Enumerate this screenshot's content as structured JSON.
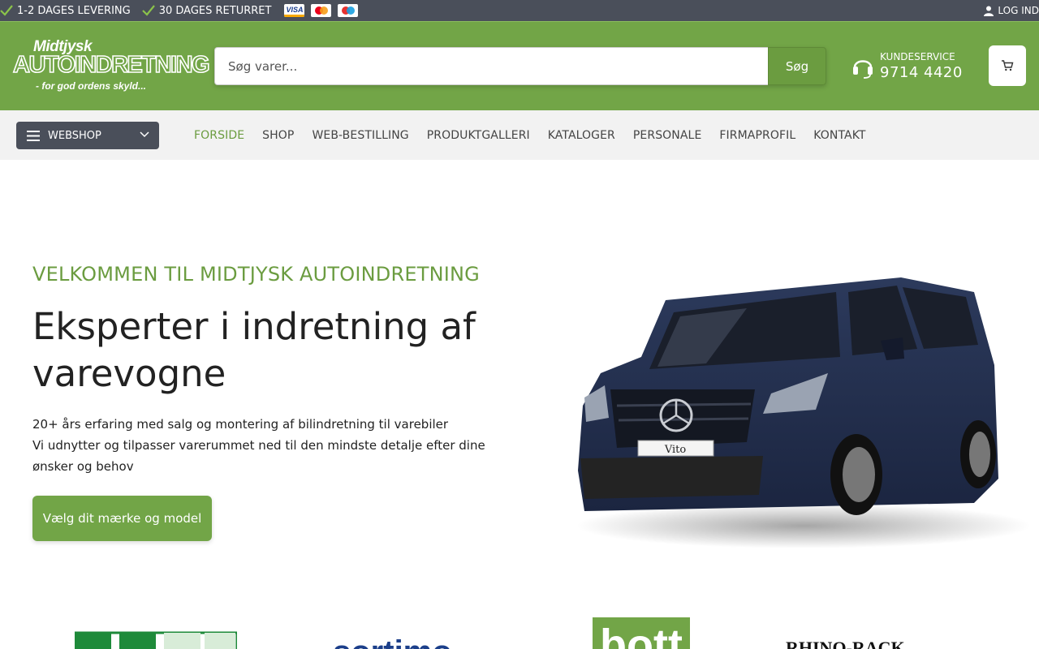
{
  "topbar": {
    "usp": [
      "1-2 DAGES LEVERING",
      "30 DAGES RETURRET"
    ],
    "cards": [
      "visa-card-icon",
      "mastercard-icon",
      "maestro-card-icon"
    ],
    "card_visa_label": "VISA",
    "login_label": "LOG IND"
  },
  "header": {
    "logo": {
      "line1": "Midtjysk",
      "line2": "AUTOINDRETNING",
      "tagline": "- for god ordens skyld..."
    },
    "search_placeholder": "Søg varer...",
    "search_button": "Søg",
    "service_label": "KUNDESERVICE",
    "service_phone": "9714 4420"
  },
  "nav": {
    "webshop_label": "WEBSHOP",
    "items": [
      "FORSIDE",
      "SHOP",
      "WEB-BESTILLING",
      "PRODUKTGALLERI",
      "KATALOGER",
      "PERSONALE",
      "FIRMAPROFIL",
      "KONTAKT"
    ],
    "active": "FORSIDE"
  },
  "hero": {
    "eyebrow": "VELKOMMEN TIL MIDTJYSK AUTOINDRETNING",
    "title": "Eksperter i indretning af varevogne",
    "line1": "20+ års erfaring med salg og montering af bilindretning til varebiler",
    "line2": "Vi udnytter og tilpasser varerummet ned til den mindste detalje efter dine ønsker og behov",
    "cta": "Vælg dit mærke og model",
    "van_plate": "Vito"
  },
  "brands": [
    "sortimo",
    "bott",
    "RHINO-RACK"
  ],
  "colors": {
    "brand_green": "#72a547",
    "dark": "#4a4f5a",
    "nav_bg": "#f2f2f2"
  }
}
